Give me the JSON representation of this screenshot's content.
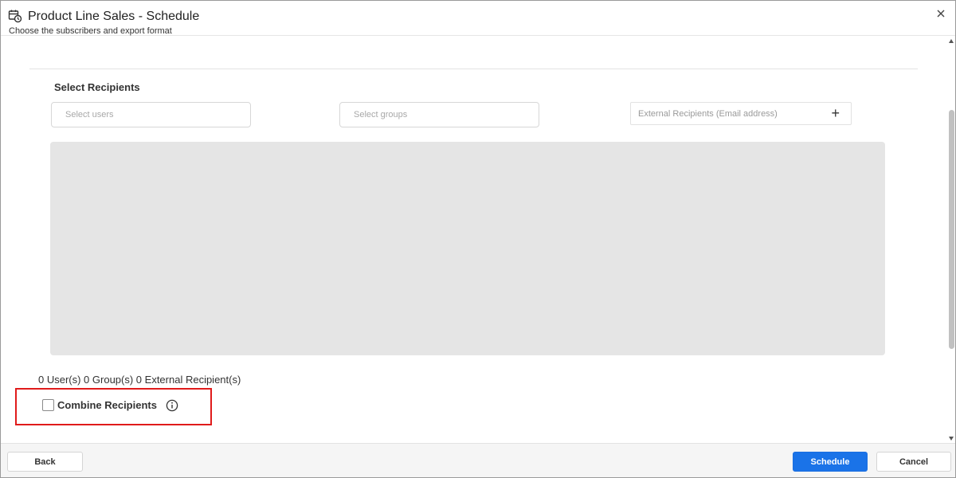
{
  "header": {
    "title": "Product Line Sales - Schedule",
    "subtitle": "Choose the subscribers and export format"
  },
  "recipients": {
    "section_title": "Select Recipients",
    "users_placeholder": "Select users",
    "groups_placeholder": "Select groups",
    "external_placeholder": "External Recipients (Email address)",
    "add_symbol": "+",
    "counts_text": "0 User(s) 0 Group(s) 0 External Recipient(s)",
    "combine_label": "Combine Recipients",
    "combine_checked": false
  },
  "footer": {
    "back_label": "Back",
    "schedule_label": "Schedule",
    "cancel_label": "Cancel"
  },
  "colors": {
    "primary": "#1a73e8",
    "highlight": "#e01b1b"
  },
  "icons": {
    "header": "calendar-clock-icon",
    "close": "close-icon",
    "info": "info-icon",
    "add": "plus-icon"
  }
}
